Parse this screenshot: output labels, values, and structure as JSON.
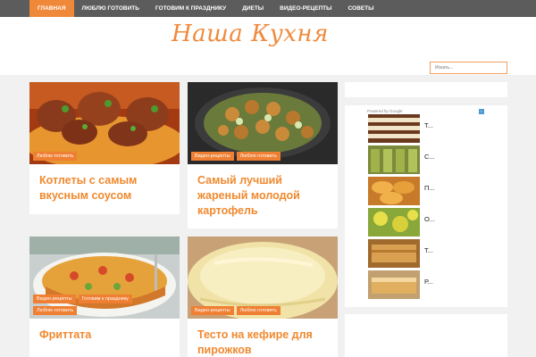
{
  "nav": {
    "items": [
      {
        "label": "ГЛАВНАЯ",
        "active": true
      },
      {
        "label": "ЛЮБЛЮ ГОТОВИТЬ"
      },
      {
        "label": "ГОТОВИМ К ПРАЗДНИКУ"
      },
      {
        "label": "ДИЕТЫ"
      },
      {
        "label": "ВИДЕО-РЕЦЕПТЫ"
      },
      {
        "label": "СОВЕТЫ"
      }
    ]
  },
  "header": {
    "logo": "Наша Кухня",
    "search_placeholder": "Искать..."
  },
  "posts": [
    {
      "title": "Котлеты с самым вкусным соусом",
      "tags": [
        "Люблю готовить"
      ]
    },
    {
      "title": "Самый лучший жареный молодой картофель",
      "tags": [
        "Видео-рецепты",
        "Люблю готовить"
      ]
    },
    {
      "title": "Фриттата",
      "tags": [
        "Видео-рецепты",
        "Готовим к празднику",
        "Люблю готовить"
      ]
    },
    {
      "title": "Тесто на кефире для пирожков",
      "tags": [
        "Видео-рецепты",
        "Люблю готовить"
      ]
    }
  ],
  "ads": {
    "label": "Powered by Google",
    "items": [
      {
        "text": "Т..."
      },
      {
        "text": "С..."
      },
      {
        "text": "П..."
      },
      {
        "text": "О..."
      },
      {
        "text": "Т..."
      },
      {
        "text": "Р..."
      }
    ]
  },
  "colors": {
    "accent": "#ef7f32",
    "nav_bg": "#5c5c5c",
    "title": "#f0892f"
  }
}
